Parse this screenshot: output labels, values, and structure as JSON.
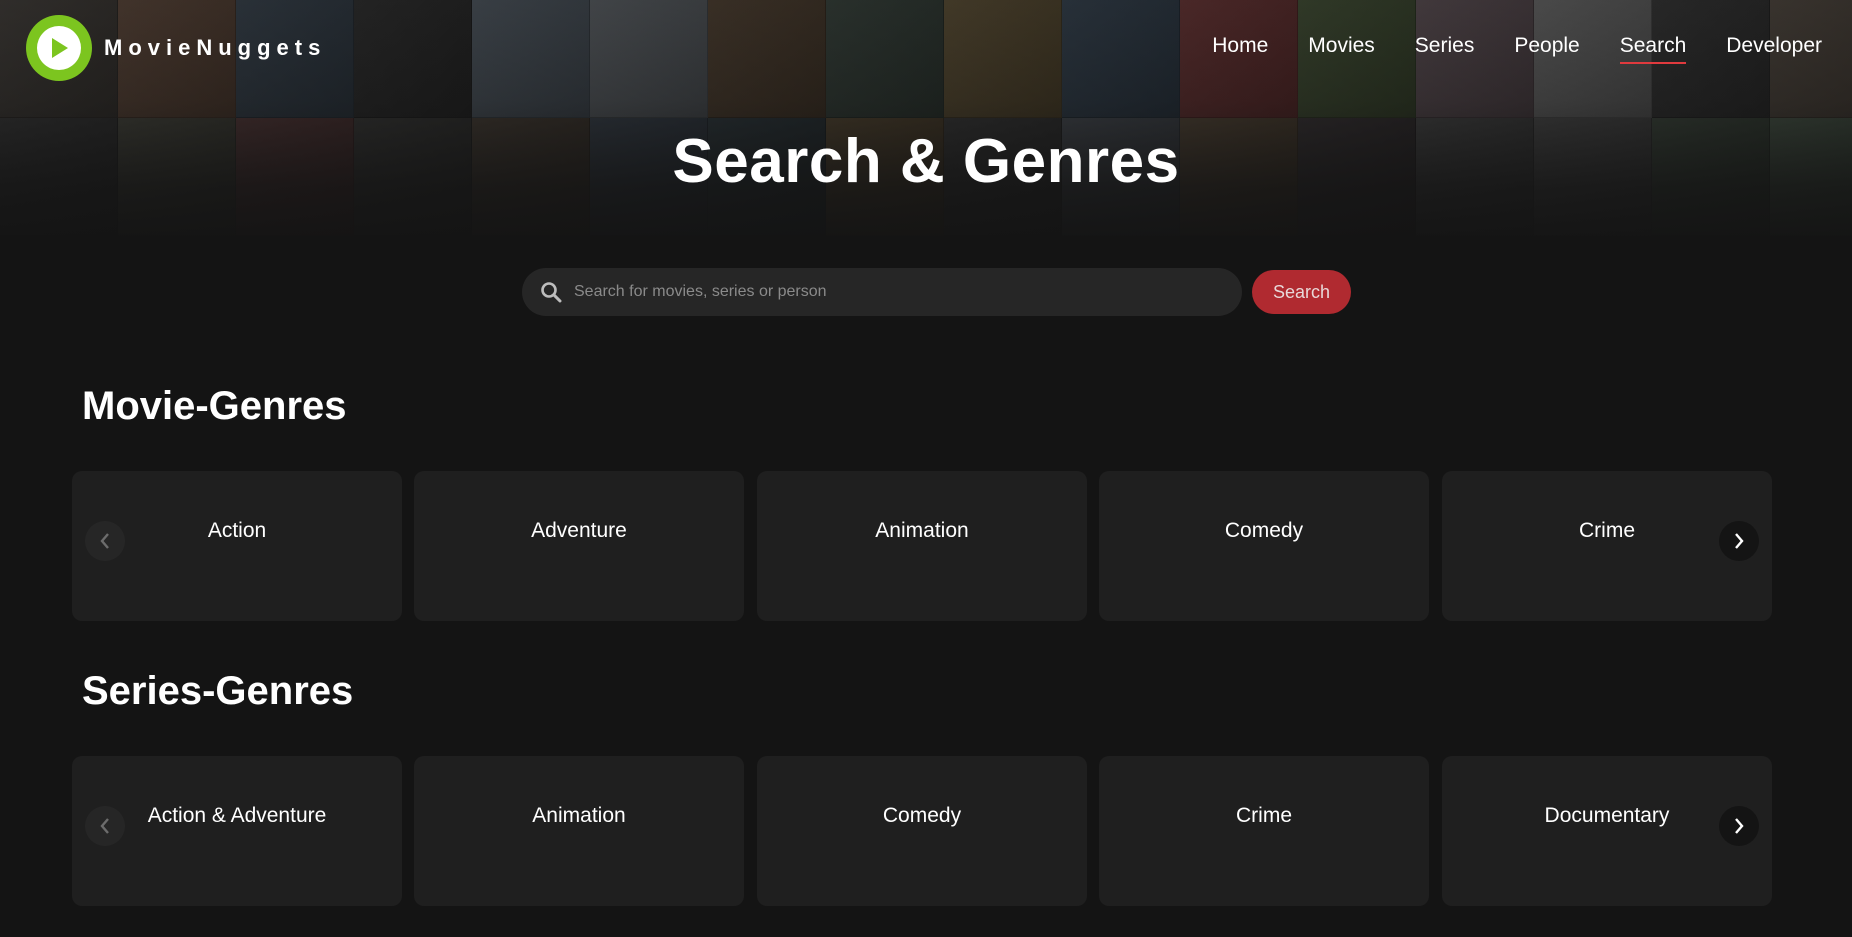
{
  "brand": {
    "name": "MovieNuggets",
    "logo_icon": "play-icon",
    "accent": "#7cc51f"
  },
  "nav": [
    {
      "label": "Home",
      "active": false
    },
    {
      "label": "Movies",
      "active": false
    },
    {
      "label": "Series",
      "active": false
    },
    {
      "label": "People",
      "active": false
    },
    {
      "label": "Search",
      "active": true
    },
    {
      "label": "Developer",
      "active": false
    }
  ],
  "page": {
    "title": "Search & Genres"
  },
  "search": {
    "placeholder": "Search for movies, series or person",
    "value": "",
    "button_label": "Search",
    "button_color": "#b02a30"
  },
  "movie_genres": {
    "title": "Movie-Genres",
    "items": [
      "Action",
      "Adventure",
      "Animation",
      "Comedy",
      "Crime"
    ]
  },
  "series_genres": {
    "title": "Series-Genres",
    "items": [
      "Action & Adventure",
      "Animation",
      "Comedy",
      "Crime",
      "Documentary"
    ]
  }
}
